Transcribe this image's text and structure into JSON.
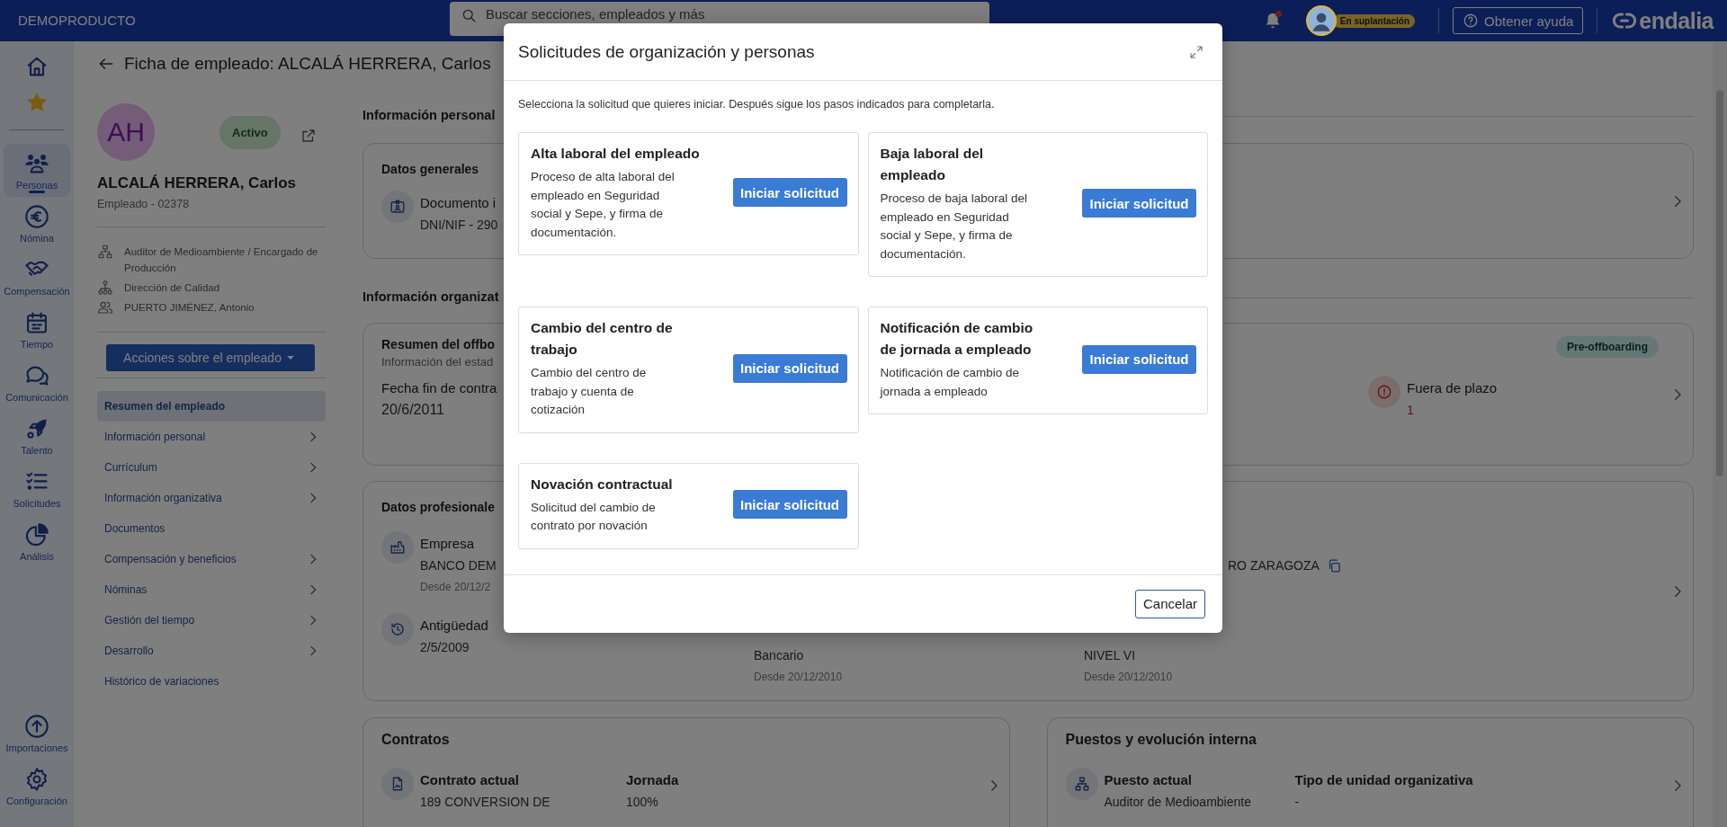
{
  "topbar": {
    "brand": "DEMOPRODUCTO",
    "search": {
      "placeholder": "Buscar secciones, empleados y más"
    },
    "notifications": {
      "unread": true
    },
    "impersonation_badge": "En suplantación",
    "help_button": "Obtener ayuda",
    "logo_text": "endalia"
  },
  "nav": {
    "shortcuts": [
      {
        "kind": "home"
      },
      {
        "kind": "favorites"
      }
    ],
    "items": [
      {
        "kind": "people",
        "label": "Personas",
        "selected": true
      },
      {
        "kind": "payroll",
        "label": "Nómina",
        "selected": false
      },
      {
        "kind": "compensation",
        "label": "Compensación",
        "selected": false
      },
      {
        "kind": "time",
        "label": "Tiempo",
        "selected": false
      },
      {
        "kind": "communication",
        "label": "Comunicación",
        "selected": false
      },
      {
        "kind": "talent",
        "label": "Talento",
        "selected": false
      },
      {
        "kind": "requests",
        "label": "Solicitudes",
        "selected": false
      },
      {
        "kind": "analytics",
        "label": "Análisis",
        "selected": false
      }
    ],
    "bottom_items": [
      {
        "kind": "imports",
        "label": "Importaciones",
        "selected": false
      },
      {
        "kind": "settings",
        "label": "Configuración",
        "selected": false
      }
    ]
  },
  "page_title": "Ficha de empleado: ALCALÁ HERRERA, Carlos",
  "profile": {
    "initials": "AH",
    "status": "Activo",
    "name": "ALCALÁ HERRERA, Carlos",
    "employee_id": "Empleado - 02378",
    "details": [
      {
        "kind": "position",
        "text": "Auditor de Medioambiente / Encargado de Producción"
      },
      {
        "kind": "department",
        "text": "Dirección de Calidad"
      },
      {
        "kind": "manager",
        "text": "PUERTO JIMÉNEZ, Antonio"
      }
    ],
    "actions_button": "Acciones sobre el empleado",
    "menu": [
      {
        "label": "Resumen del empleado",
        "selected": true,
        "submenu": false
      },
      {
        "label": "Información personal",
        "selected": false,
        "submenu": true
      },
      {
        "label": "Currículum",
        "selected": false,
        "submenu": true
      },
      {
        "label": "Información organizativa",
        "selected": false,
        "submenu": true
      },
      {
        "label": "Documentos",
        "selected": false,
        "submenu": false
      },
      {
        "label": "Compensación y beneficios",
        "selected": false,
        "submenu": true
      },
      {
        "label": "Nóminas",
        "selected": false,
        "submenu": true
      },
      {
        "label": "Gestión del tiempo",
        "selected": false,
        "submenu": true
      },
      {
        "label": "Desarrollo",
        "selected": false,
        "submenu": true
      },
      {
        "label": "Histórico de variaciones",
        "selected": false,
        "submenu": false
      }
    ]
  },
  "main": {
    "section_1": "Información personal",
    "general_data": {
      "title": "Datos generales",
      "label": "Documento i",
      "value": "DNI/NIF - 290"
    },
    "section_2": "Información organizat",
    "offboarding": {
      "title": "Resumen del offbo",
      "subtitle": "Información del estad",
      "label": "Fecha fin de contra",
      "value": "20/6/2011",
      "badge": "Pre-offboarding",
      "alert_label": "Fuera de plazo",
      "alert_value": "1"
    },
    "professional_data": {
      "title": "Datos profesionale",
      "company": {
        "label": "Empresa",
        "value": "BANCO DEM",
        "since": "Desde 20/12/2"
      },
      "seniority": {
        "label": "Antigüedad",
        "value": "2/5/2009"
      },
      "column_2": {
        "value": "Bancario",
        "since": "Desde 20/12/2010"
      },
      "column_3": [
        {
          "value": "RO ZARAGOZA",
          "copyable": true
        },
        {
          "value": "NIVEL VI",
          "since": "Desde 20/12/2010",
          "copyable": false
        }
      ]
    },
    "contracts": {
      "title": "Contratos",
      "label": "Contrato actual",
      "value": "189 CONVERSION DE",
      "label_2": "Jornada",
      "value_2": "100%"
    },
    "positions": {
      "title": "Puestos y evolución interna",
      "label": "Puesto actual",
      "value": "Auditor de Medioambiente",
      "label_2": "Tipo de unidad organizativa",
      "value_2": "-"
    }
  },
  "modal": {
    "title": "Solicitudes de organización y personas",
    "description": "Selecciona la solicitud que quieres iniciar. Después sigue los pasos indicados para completarla.",
    "requests": [
      {
        "title": "Alta laboral del empleado",
        "description": "Proceso de alta laboral del empleado en Seguridad social y Sepe, y firma de documentación.",
        "button": "Iniciar solicitud"
      },
      {
        "title": "Baja laboral del empleado",
        "description": "Proceso de baja laboral del empleado en Seguridad social y Sepe, y firma de documentación.",
        "button": "Iniciar solicitud"
      },
      {
        "title": "Cambio del centro de trabajo",
        "description": "Cambio del centro de trabajo y cuenta de cotización",
        "button": "Iniciar solicitud"
      },
      {
        "title": "Notificación de cambio de jornada a empleado",
        "description": "Notificación de cambio de jornada a empleado",
        "button": "Iniciar solicitud"
      },
      {
        "title": "Novación contractual",
        "description": "Solicitud del cambio de contrato por novación",
        "button": "Iniciar solicitud"
      }
    ],
    "cancel_button": "Cancelar"
  }
}
